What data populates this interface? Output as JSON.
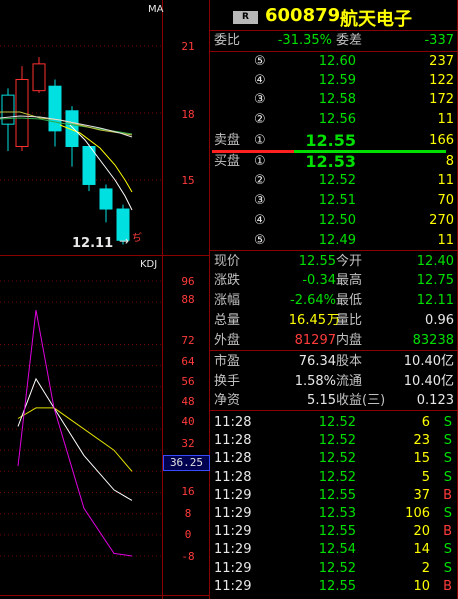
{
  "stock": {
    "badge": "R",
    "code": "600879",
    "name": "航天电子"
  },
  "kline": {
    "ma_label": "MA",
    "price_ticks": [
      "21",
      "18",
      "15"
    ],
    "low_price_label": "12.11",
    "candles": [
      {
        "open": 17.5,
        "close": 18.8,
        "high": 19.1,
        "low": 16.3,
        "color": "#00e0e0"
      },
      {
        "open": 16.5,
        "close": 19.5,
        "high": 20.1,
        "low": 16.3,
        "color": "#ff3030"
      },
      {
        "open": 19.0,
        "close": 20.2,
        "high": 20.5,
        "low": 18.9,
        "color": "#ff3030"
      },
      {
        "open": 19.2,
        "close": 17.2,
        "high": 19.5,
        "low": 16.5,
        "color": "#00e0e0"
      },
      {
        "open": 18.1,
        "close": 16.5,
        "high": 18.3,
        "low": 15.6,
        "color": "#00e0e0"
      },
      {
        "open": 16.5,
        "close": 14.8,
        "high": 16.6,
        "low": 14.5,
        "color": "#00e0e0"
      },
      {
        "open": 14.6,
        "close": 13.7,
        "high": 14.8,
        "low": 13.1,
        "color": "#00e0e0"
      },
      {
        "open": 13.7,
        "close": 12.3,
        "high": 13.9,
        "low": 12.11,
        "color": "#00e0e0"
      }
    ]
  },
  "kdj": {
    "label": "KDJ",
    "ticks": [
      "96",
      "88",
      "72",
      "64",
      "56",
      "48",
      "40",
      "32",
      "24",
      "16",
      "8",
      "0",
      "-8"
    ],
    "current_value": "36.25",
    "k": [
      41,
      59,
      48,
      30,
      17,
      13
    ],
    "d": [
      44,
      48,
      48,
      40,
      32,
      24
    ],
    "j": [
      26,
      85,
      48,
      10,
      -7,
      -8
    ]
  },
  "quote": {
    "ratio": {
      "label": "委比",
      "value": "-31.35%",
      "diff_label": "委差",
      "diff": "-337"
    },
    "sell": [
      {
        "level": "⑤",
        "price": "12.60",
        "vol": "237"
      },
      {
        "level": "④",
        "price": "12.59",
        "vol": "122"
      },
      {
        "level": "③",
        "price": "12.58",
        "vol": "172"
      },
      {
        "level": "②",
        "price": "12.56",
        "vol": "11"
      },
      {
        "label": "卖盘",
        "level": "①",
        "price": "12.55",
        "vol": "166"
      }
    ],
    "buy": [
      {
        "label": "买盘",
        "level": "①",
        "price": "12.53",
        "vol": "8"
      },
      {
        "level": "②",
        "price": "12.52",
        "vol": "11"
      },
      {
        "level": "③",
        "price": "12.51",
        "vol": "70"
      },
      {
        "level": "④",
        "price": "12.50",
        "vol": "270"
      },
      {
        "level": "⑤",
        "price": "12.49",
        "vol": "11"
      }
    ]
  },
  "stats": [
    {
      "l1": "现价",
      "v1": "12.55",
      "l2": "今开",
      "v2": "12.40"
    },
    {
      "l1": "涨跌",
      "v1": "-0.34",
      "l2": "最高",
      "v2": "12.75"
    },
    {
      "l1": "涨幅",
      "v1": "-2.64%",
      "l2": "最低",
      "v2": "12.11"
    },
    {
      "l1": "总量",
      "v1": "16.45",
      "v1_unit": "万",
      "l2": "量比",
      "v2": "0.96"
    },
    {
      "l1": "外盘",
      "v1": "81297",
      "l2": "内盘",
      "v2": "83238"
    }
  ],
  "fund": [
    {
      "l1": "市盈",
      "v1": "76.34",
      "l2": "股本",
      "v2": "10.40亿"
    },
    {
      "l1": "换手",
      "v1": "1.58%",
      "l2": "流通",
      "v2": "10.40亿"
    },
    {
      "l1": "净资",
      "v1": "5.15",
      "l2": "收益(三)",
      "v2": "0.123"
    }
  ],
  "trades": [
    {
      "time": "11:28",
      "price": "12.52",
      "vol": "6",
      "side": "S"
    },
    {
      "time": "11:28",
      "price": "12.52",
      "vol": "23",
      "side": "S"
    },
    {
      "time": "11:28",
      "price": "12.52",
      "vol": "15",
      "side": "S"
    },
    {
      "time": "11:28",
      "price": "12.52",
      "vol": "5",
      "side": "S"
    },
    {
      "time": "11:29",
      "price": "12.55",
      "vol": "37",
      "side": "B"
    },
    {
      "time": "11:29",
      "price": "12.53",
      "vol": "106",
      "side": "S"
    },
    {
      "time": "11:29",
      "price": "12.55",
      "vol": "20",
      "side": "B"
    },
    {
      "time": "11:29",
      "price": "12.54",
      "vol": "14",
      "side": "S"
    },
    {
      "time": "11:29",
      "price": "12.52",
      "vol": "2",
      "side": "S"
    },
    {
      "time": "11:29",
      "price": "12.55",
      "vol": "10",
      "side": "B"
    }
  ]
}
